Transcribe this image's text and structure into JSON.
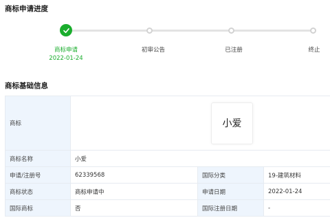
{
  "progress": {
    "title": "商标申请进度",
    "steps": [
      {
        "label": "商标申请",
        "date": "2022-01-24",
        "status": "done"
      },
      {
        "label": "初审公告",
        "status": "pending"
      },
      {
        "label": "已注册",
        "status": "pending"
      },
      {
        "label": "终止",
        "status": "pending"
      }
    ]
  },
  "basic": {
    "title": "商标基础信息",
    "logo_label": "商标",
    "logo_text": "小爱",
    "name_label": "商标名称",
    "name_value": "小爱",
    "rows": [
      {
        "label1": "申请/注册号",
        "value1": "62339568",
        "label2": "国际分类",
        "value2": "19-建筑材料"
      },
      {
        "label1": "商标状态",
        "value1": "商标申请中",
        "label2": "申请日期",
        "value2": "2022-01-24"
      },
      {
        "label1": "国际商标",
        "value1": "否",
        "label2": "国际注册日期",
        "value2": "-"
      }
    ]
  },
  "colors": {
    "accent": "#1aad2d",
    "label_bg": "#eef5fd",
    "border": "#e6ebf1"
  },
  "icons": {
    "done_step": "check-icon",
    "pending_step": "circle-dot-icon"
  }
}
